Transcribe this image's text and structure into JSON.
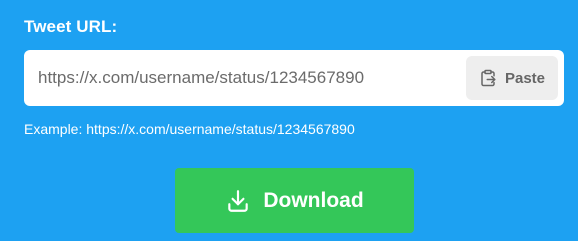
{
  "form": {
    "label": "Tweet URL:",
    "url_input": {
      "value": "",
      "placeholder": "https://x.com/username/status/1234567890"
    },
    "paste_button": {
      "label": "Paste",
      "icon": "clipboard-paste-icon"
    },
    "example_text": "Example: https://x.com/username/status/1234567890",
    "download_button": {
      "label": "Download",
      "icon": "download-icon"
    }
  },
  "colors": {
    "background": "#1da1f2",
    "download_button": "#34c759",
    "paste_button": "#eeeeee",
    "input_background": "#ffffff"
  }
}
